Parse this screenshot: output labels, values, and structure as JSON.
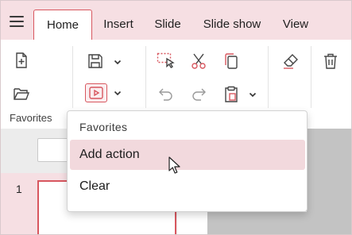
{
  "tabs": [
    {
      "label": "Home",
      "active": true
    },
    {
      "label": "Insert",
      "active": false
    },
    {
      "label": "Slide",
      "active": false
    },
    {
      "label": "Slide show",
      "active": false
    },
    {
      "label": "View",
      "active": false
    }
  ],
  "ribbon": {
    "group_label": "Favorites",
    "icons": [
      "new-file-icon",
      "open-folder-icon",
      "save-icon",
      "play-slideshow-icon",
      "select-icon",
      "cut-icon",
      "copy-icon",
      "undo-icon",
      "redo-icon",
      "paste-icon",
      "eraser-icon",
      "delete-icon"
    ]
  },
  "slides": {
    "current_number": "1"
  },
  "menu": {
    "header": "Favorites",
    "items": [
      {
        "label": "Add action",
        "hovered": true
      },
      {
        "label": "Clear",
        "hovered": false
      }
    ]
  },
  "colors": {
    "accent": "#d8575f",
    "tabbar_bg": "#f6dfe3",
    "hover_bg": "#f2d9dd"
  }
}
